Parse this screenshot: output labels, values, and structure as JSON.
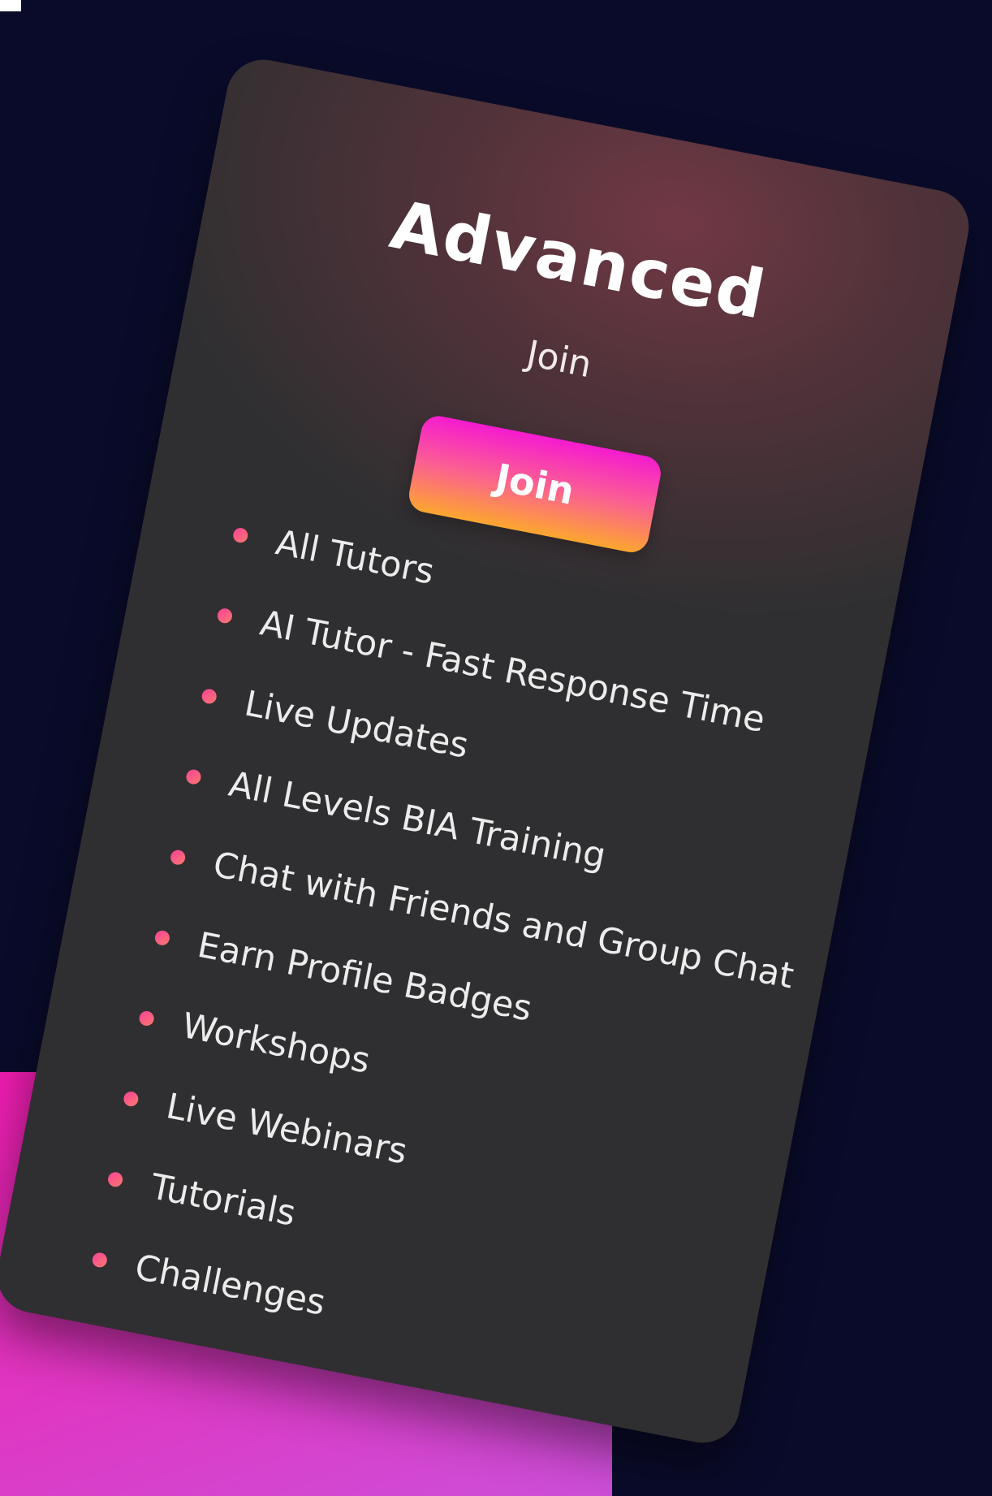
{
  "plan": {
    "title": "Advanced",
    "subtitle": "Join",
    "join_label": "Join",
    "features": [
      "All Tutors",
      "AI Tutor - Fast Response Time",
      "Live Updates",
      "All Levels BIA Training",
      "Chat with Friends and Group Chat",
      "Earn Profile Badges",
      "Workshops",
      "Live Webinars",
      "Tutorials",
      "Challenges"
    ]
  },
  "colors": {
    "background": "#0a0b2a",
    "card": "#2f2f31",
    "accent_pink": "#f51bd0",
    "accent_orange": "#fca62f",
    "bullet": "#f8409b",
    "side_block": "#ef1cb0"
  },
  "icons": {
    "bullet": "bullet-dot-icon"
  }
}
